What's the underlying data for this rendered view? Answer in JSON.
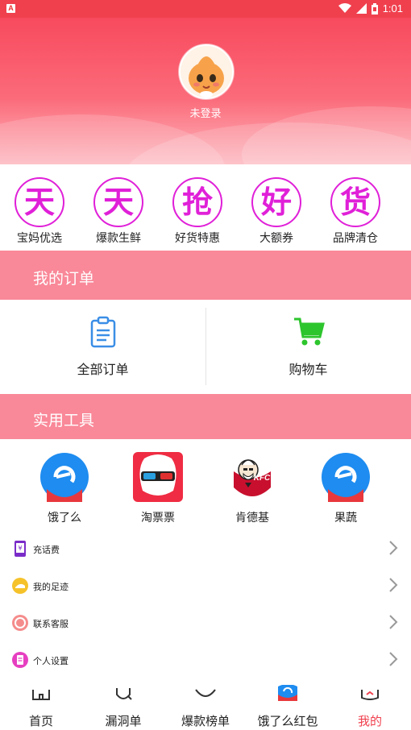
{
  "status_bar": {
    "time": "1:01",
    "notification_badge": "A"
  },
  "profile": {
    "login_status": "未登录"
  },
  "quick_actions": [
    {
      "glyph": "天",
      "label": "宝妈优选"
    },
    {
      "glyph": "天",
      "label": "爆款生鲜"
    },
    {
      "glyph": "抢",
      "label": "好货特惠"
    },
    {
      "glyph": "好",
      "label": "大额券"
    },
    {
      "glyph": "货",
      "label": "品牌清仓"
    }
  ],
  "orders_section": {
    "title": "我的订单",
    "items": [
      {
        "label": "全部订单",
        "icon": "clipboard-icon"
      },
      {
        "label": "购物车",
        "icon": "shopping-cart-icon"
      }
    ]
  },
  "tools_section": {
    "title": "实用工具",
    "items": [
      {
        "label": "饿了么",
        "icon": "eleme-icon"
      },
      {
        "label": "淘票票",
        "icon": "taopiaopiao-icon"
      },
      {
        "label": "肯德基",
        "icon": "kfc-icon"
      },
      {
        "label": "果蔬",
        "icon": "eleme-icon"
      }
    ],
    "kfc_logo_text": "KFC"
  },
  "menu": [
    {
      "label": "充话费",
      "icon": "phone-recharge-icon"
    },
    {
      "label": "我的足迹",
      "icon": "footprint-icon"
    },
    {
      "label": "联系客服",
      "icon": "customer-service-icon"
    },
    {
      "label": "个人设置",
      "icon": "settings-icon"
    }
  ],
  "tab_bar": [
    {
      "label": "首页",
      "icon": "home-icon",
      "active": false
    },
    {
      "label": "漏洞单",
      "icon": "bug-list-icon",
      "active": false
    },
    {
      "label": "爆款榜单",
      "icon": "hot-list-icon",
      "active": false
    },
    {
      "label": "饿了么红包",
      "icon": "eleme-redpacket-icon",
      "active": false
    },
    {
      "label": "我的",
      "icon": "profile-icon",
      "active": true
    }
  ],
  "colors": {
    "primary": "#f0404e",
    "section_bg": "#f98898",
    "quick_accent": "#e020d8",
    "cart_green": "#2dc52d",
    "clipboard_blue": "#3a8ee6"
  }
}
